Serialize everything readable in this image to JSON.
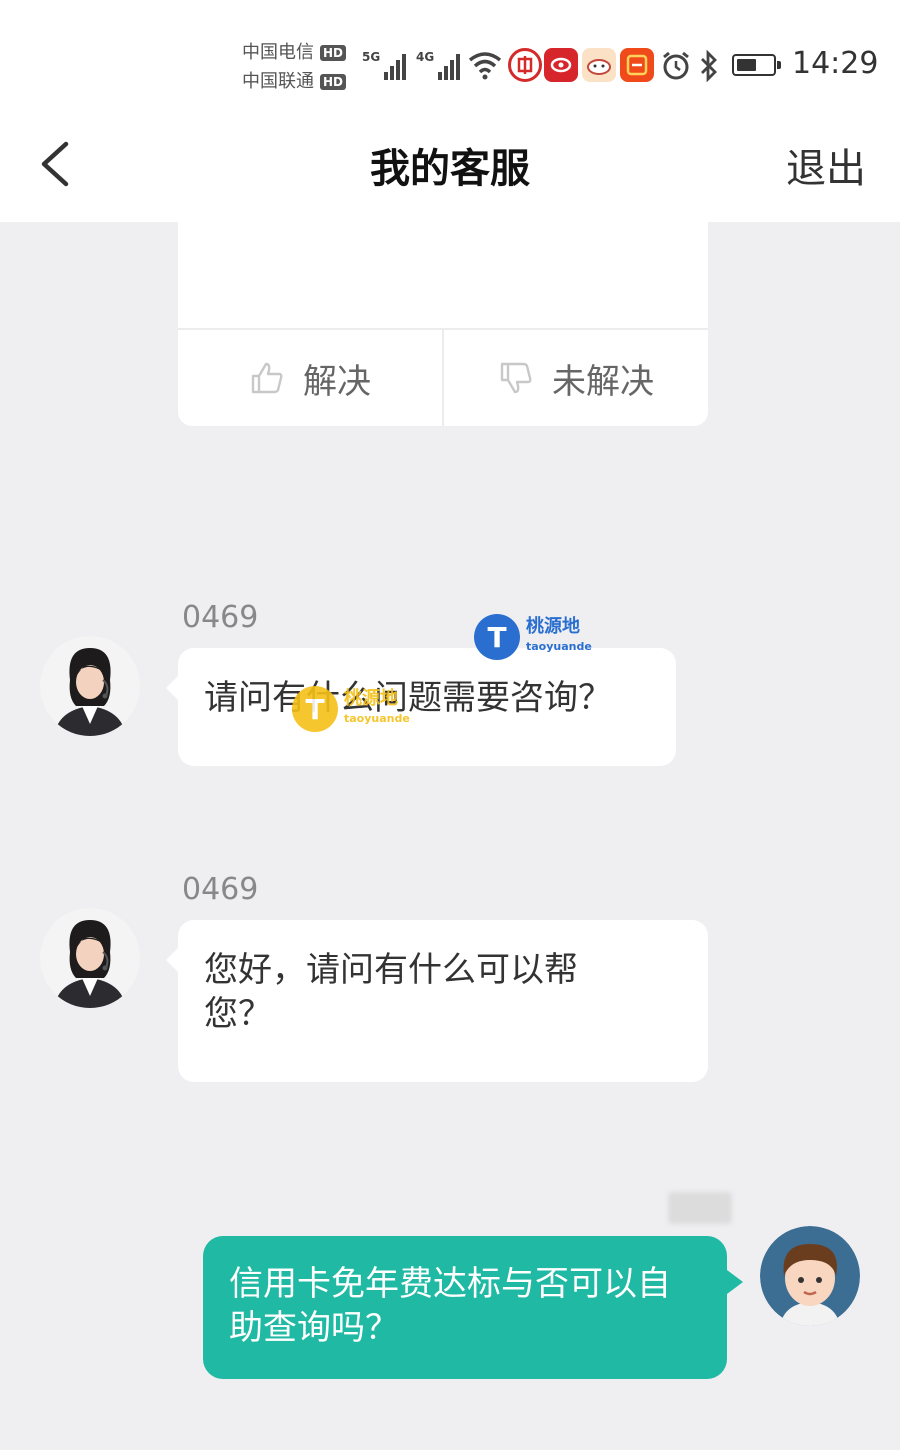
{
  "status_bar": {
    "carrier_1": "中国电信",
    "carrier_2": "中国联通",
    "hd_badge": "HD",
    "net_1": "5G",
    "net_2": "4G",
    "time": "14:29",
    "battery_level": 0.55
  },
  "header": {
    "title": "我的客服",
    "exit_label": "退出"
  },
  "feedback": {
    "resolved_label": "解决",
    "unresolved_label": "未解决"
  },
  "messages": [
    {
      "sender": "0469",
      "text": "请问有什么问题需要咨询？"
    },
    {
      "sender": "0469",
      "text": "您好，请问有什么可以帮您？"
    },
    {
      "text": "信用卡免年费达标与否可以自助查询吗？"
    }
  ],
  "watermark": {
    "glyph": "T",
    "name": "桃源地",
    "domain": "taoyuande"
  },
  "colors": {
    "user_bubble": "#1fb9a4",
    "background": "#efeff2",
    "watermark_blue": "#2a6fd0",
    "watermark_yellow": "#f5c018"
  }
}
